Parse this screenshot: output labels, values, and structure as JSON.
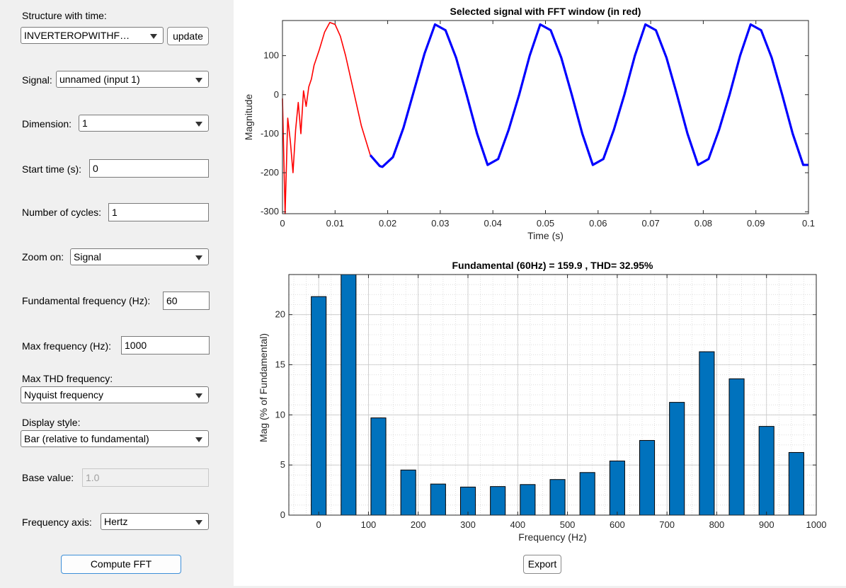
{
  "controls": {
    "structure_label": "Structure with time:",
    "structure_value": "INVERTEROPWITHF…",
    "update_label": "update",
    "signal_label": "Signal:",
    "signal_value": "unnamed (input 1)",
    "dimension_label": "Dimension:",
    "dimension_value": "1",
    "start_time_label": "Start time (s):",
    "start_time_value": "0",
    "cycles_label": "Number of cycles:",
    "cycles_value": "1",
    "zoom_label": "Zoom on:",
    "zoom_value": "Signal",
    "fund_freq_label": "Fundamental frequency (Hz):",
    "fund_freq_value": "60",
    "max_freq_label": "Max frequency (Hz):",
    "max_freq_value": "1000",
    "max_thd_label": "Max THD frequency:",
    "max_thd_value": "Nyquist frequency",
    "display_style_label": "Display style:",
    "display_style_value": "Bar (relative to fundamental)",
    "base_value_label": "Base value:",
    "base_value_value": "1.0",
    "freq_axis_label": "Frequency axis:",
    "freq_axis_value": "Hertz",
    "compute_label": "Compute FFT",
    "export_label": "Export"
  },
  "colors": {
    "fft_window": "#ff0000",
    "signal": "#0000ff",
    "bar": "#0072bd"
  },
  "chart_data": [
    {
      "type": "line",
      "title": "Selected signal with FFT window (in red)",
      "xlabel": "Time (s)",
      "ylabel": "Magnitude",
      "xlim": [
        0,
        0.1
      ],
      "ylim": [
        -305,
        190
      ],
      "xticks": [
        0,
        0.01,
        0.02,
        0.03,
        0.04,
        0.05,
        0.06,
        0.07,
        0.08,
        0.09,
        0.1
      ],
      "xtick_labels": [
        "0",
        "0.01",
        "0.02",
        "0.03",
        "0.04",
        "0.05",
        "0.06",
        "0.07",
        "0.08",
        "0.09",
        "0.1"
      ],
      "yticks": [
        -300,
        -200,
        -100,
        0,
        100
      ],
      "ytick_labels": [
        "-300",
        "-200",
        "-100",
        "0",
        "100"
      ],
      "series": [
        {
          "color": "#ff0000",
          "x": [
            0,
            0.0005,
            0.001,
            0.0015,
            0.002,
            0.0025,
            0.003,
            0.0035,
            0.004,
            0.0045,
            0.005,
            0.0055,
            0.006,
            0.007,
            0.008,
            0.009,
            0.01,
            0.011,
            0.012,
            0.013,
            0.014,
            0.015,
            0.0167
          ],
          "y": [
            -10,
            -305,
            -60,
            -120,
            -200,
            -90,
            -20,
            -100,
            10,
            -30,
            20,
            40,
            75,
            115,
            160,
            185,
            180,
            150,
            100,
            40,
            -20,
            -80,
            -155
          ]
        },
        {
          "color": "#0000ff",
          "x": [
            0.0167,
            0.0185,
            0.019,
            0.021,
            0.023,
            0.025,
            0.027,
            0.029,
            0.031,
            0.033,
            0.035,
            0.037,
            0.039,
            0.041,
            0.043,
            0.045,
            0.047,
            0.049,
            0.051,
            0.053,
            0.055,
            0.057,
            0.059,
            0.061,
            0.063,
            0.065,
            0.067,
            0.069,
            0.071,
            0.073,
            0.075,
            0.077,
            0.079,
            0.081,
            0.083,
            0.085,
            0.087,
            0.089,
            0.091,
            0.093,
            0.095,
            0.097,
            0.099,
            0.1
          ],
          "y": [
            -155,
            -183,
            -185,
            -160,
            -85,
            10,
            105,
            180,
            165,
            95,
            0,
            -100,
            -180,
            -165,
            -90,
            0,
            100,
            180,
            165,
            95,
            0,
            -100,
            -180,
            -165,
            -90,
            0,
            100,
            180,
            165,
            95,
            0,
            -100,
            -180,
            -165,
            -90,
            0,
            100,
            180,
            165,
            95,
            0,
            -100,
            -180,
            -180
          ]
        }
      ]
    },
    {
      "type": "bar",
      "title": "Fundamental (60Hz) = 159.9 , THD= 32.95%",
      "xlabel": "Frequency (Hz)",
      "ylabel": "Mag (% of Fundamental)",
      "xlim": [
        -60,
        1000
      ],
      "ylim": [
        0,
        24
      ],
      "xticks": [
        0,
        100,
        200,
        300,
        400,
        500,
        600,
        700,
        800,
        900,
        1000
      ],
      "xtick_labels": [
        "0",
        "100",
        "200",
        "300",
        "400",
        "500",
        "600",
        "700",
        "800",
        "900",
        "1000"
      ],
      "yticks": [
        0,
        5,
        10,
        15,
        20
      ],
      "ytick_labels": [
        "0",
        "5",
        "10",
        "15",
        "20"
      ],
      "bar_width_hz": 30,
      "x": [
        0,
        60,
        120,
        180,
        240,
        300,
        360,
        420,
        480,
        540,
        600,
        660,
        720,
        780,
        840,
        900,
        960
      ],
      "values": [
        21.8,
        24,
        9.7,
        4.5,
        3.1,
        2.8,
        2.85,
        3.05,
        3.55,
        4.25,
        5.4,
        7.45,
        11.25,
        16.3,
        13.6,
        8.85,
        6.25
      ],
      "grid": "major and minor"
    }
  ]
}
